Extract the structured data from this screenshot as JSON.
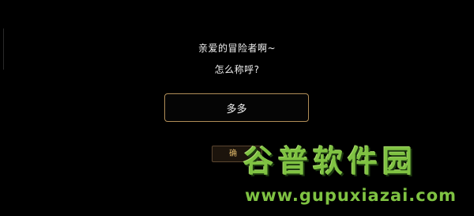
{
  "dialog": {
    "greeting": "亲爱的冒险者啊~",
    "question": "怎么称呼?",
    "name_value": "多多",
    "confirm_label": "确"
  },
  "watermark": {
    "title": "谷普软件园",
    "url": "www.gupuxiazai.com"
  },
  "colors": {
    "background": "#000000",
    "input_border": "#b08d57",
    "button_text": "#e0b96a",
    "watermark_green": "#7fc242"
  }
}
